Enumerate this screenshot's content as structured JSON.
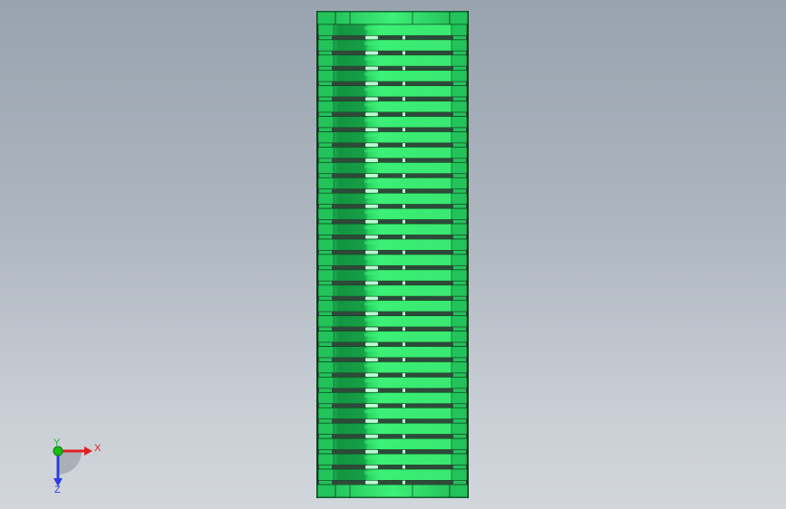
{
  "viewport": {
    "background_top": "#98a3af",
    "background_bottom": "#d2d6dc"
  },
  "model": {
    "description_icon": "roller-conveyor-model",
    "roller_count": 30,
    "colors": {
      "bright": "#3df077",
      "mid": "#22c35a",
      "dark": "#139540",
      "edge": "#0b3b1c",
      "slot": "#2e4a39",
      "highlight": "#b7ffd0"
    }
  },
  "triad": {
    "x_label": "X",
    "y_label": "Y",
    "z_label": "Z",
    "colors": {
      "x": "#e02020",
      "y": "#16c016",
      "z": "#2a3ee0"
    }
  }
}
